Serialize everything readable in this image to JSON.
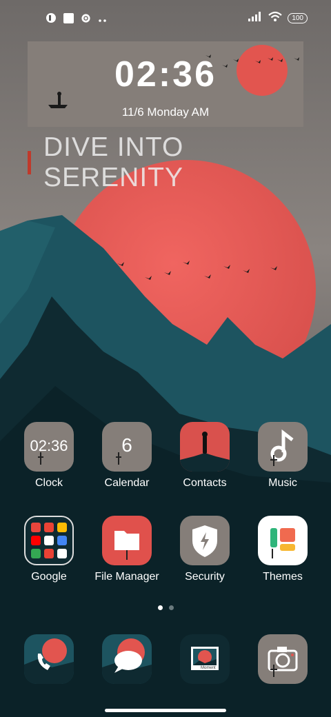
{
  "status_bar": {
    "battery": "100",
    "left_icons": [
      "app-notification-icon",
      "white-square-icon",
      "settings-gear-icon",
      "more-dots-icon"
    ],
    "right_icons": [
      "signal-icon",
      "wifi-icon",
      "battery-icon"
    ]
  },
  "widget": {
    "time": "02:36",
    "date": "11/6 Monday AM"
  },
  "tagline": "DIVE INTO SERENITY",
  "apps": [
    {
      "label": "Clock",
      "icon_text": "02:36"
    },
    {
      "label": "Calendar",
      "icon_text": "6"
    },
    {
      "label": "Contacts"
    },
    {
      "label": "Music"
    },
    {
      "label": "Google"
    },
    {
      "label": "File Manager"
    },
    {
      "label": "Security"
    },
    {
      "label": "Themes"
    }
  ],
  "dock": {
    "phone_icon": "phone-icon",
    "messages_icon": "messages-icon",
    "gallery_icon": "gallery-icon",
    "gallery_text": "Moment",
    "camera_icon": "camera-icon"
  },
  "pager": {
    "pages": 2,
    "active": 1
  },
  "colors": {
    "sun": "#e2554f",
    "sky_top": "#6f6a68",
    "teal_mountain": "#1d5560",
    "dark_mountain": "#0f2a31",
    "accent": "#c0392b"
  }
}
